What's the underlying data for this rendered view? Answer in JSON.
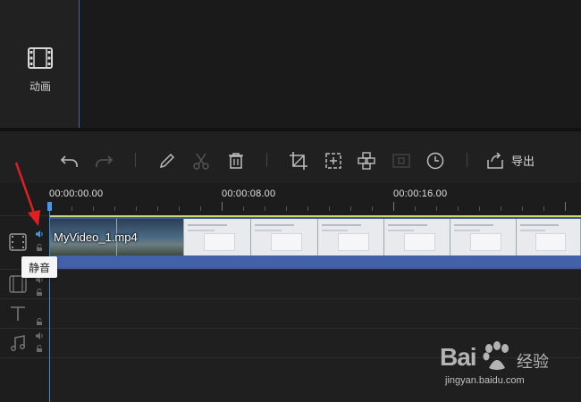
{
  "sidebar": {
    "animation_label": "动画"
  },
  "toolbar": {
    "export_label": "导出"
  },
  "ruler": {
    "labels": [
      "00:00:00.00",
      "00:00:08.00",
      "00:00:16.00"
    ]
  },
  "timeline": {
    "clip_name": "MyVideo_1.mp4"
  },
  "tooltip": {
    "mute_label": "静音"
  },
  "watermark": {
    "brand": "Bai",
    "brand_cn": "经验",
    "url": "jingyan.baidu.com"
  },
  "colors": {
    "playhead": "#3d8ad8",
    "clip_audio": "#4261a8",
    "clip_border": "#cfd86a",
    "accent_red": "#e02020"
  }
}
